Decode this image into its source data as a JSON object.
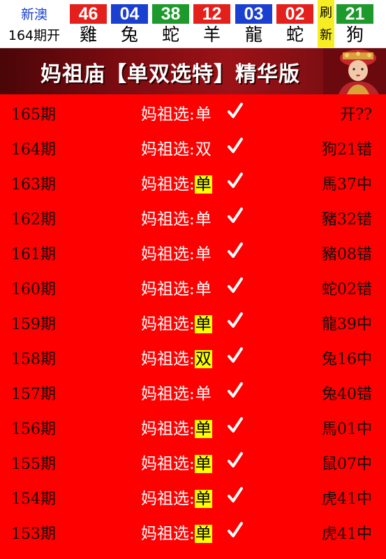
{
  "region": {
    "name": "新澳",
    "issue": "164期开"
  },
  "balls": [
    {
      "num": "46",
      "zodiac": "雞",
      "color": "red"
    },
    {
      "num": "04",
      "zodiac": "兔",
      "color": "blue"
    },
    {
      "num": "38",
      "zodiac": "蛇",
      "color": "green"
    },
    {
      "num": "12",
      "zodiac": "羊",
      "color": "red"
    },
    {
      "num": "03",
      "zodiac": "龍",
      "color": "blue"
    },
    {
      "num": "02",
      "zodiac": "蛇",
      "color": "red"
    }
  ],
  "refresh": {
    "line1": "刷",
    "line2": "新"
  },
  "special": {
    "num": "21",
    "zodiac": "狗",
    "color": "green"
  },
  "banner": {
    "title": "妈祖庙【单双选特】精华版"
  },
  "pick_label": "妈祖选:",
  "rows": [
    {
      "period": "165期",
      "value": "单",
      "highlight": false,
      "result": "开??"
    },
    {
      "period": "164期",
      "value": "双",
      "highlight": false,
      "result": "狗21错"
    },
    {
      "period": "163期",
      "value": "单",
      "highlight": true,
      "result": "馬37中"
    },
    {
      "period": "162期",
      "value": "单",
      "highlight": false,
      "result": "豬32错"
    },
    {
      "period": "161期",
      "value": "单",
      "highlight": false,
      "result": "豬08错"
    },
    {
      "period": "160期",
      "value": "单",
      "highlight": false,
      "result": "蛇02错"
    },
    {
      "period": "159期",
      "value": "单",
      "highlight": true,
      "result": "龍39中"
    },
    {
      "period": "158期",
      "value": "双",
      "highlight": true,
      "result": "兔16中"
    },
    {
      "period": "157期",
      "value": "单",
      "highlight": false,
      "result": "兔40错"
    },
    {
      "period": "156期",
      "value": "单",
      "highlight": true,
      "result": "馬01中"
    },
    {
      "period": "155期",
      "value": "单",
      "highlight": true,
      "result": "鼠07中"
    },
    {
      "period": "154期",
      "value": "单",
      "highlight": true,
      "result": "虎41中"
    },
    {
      "period": "153期",
      "value": "单",
      "highlight": true,
      "result": "虎41中"
    }
  ]
}
